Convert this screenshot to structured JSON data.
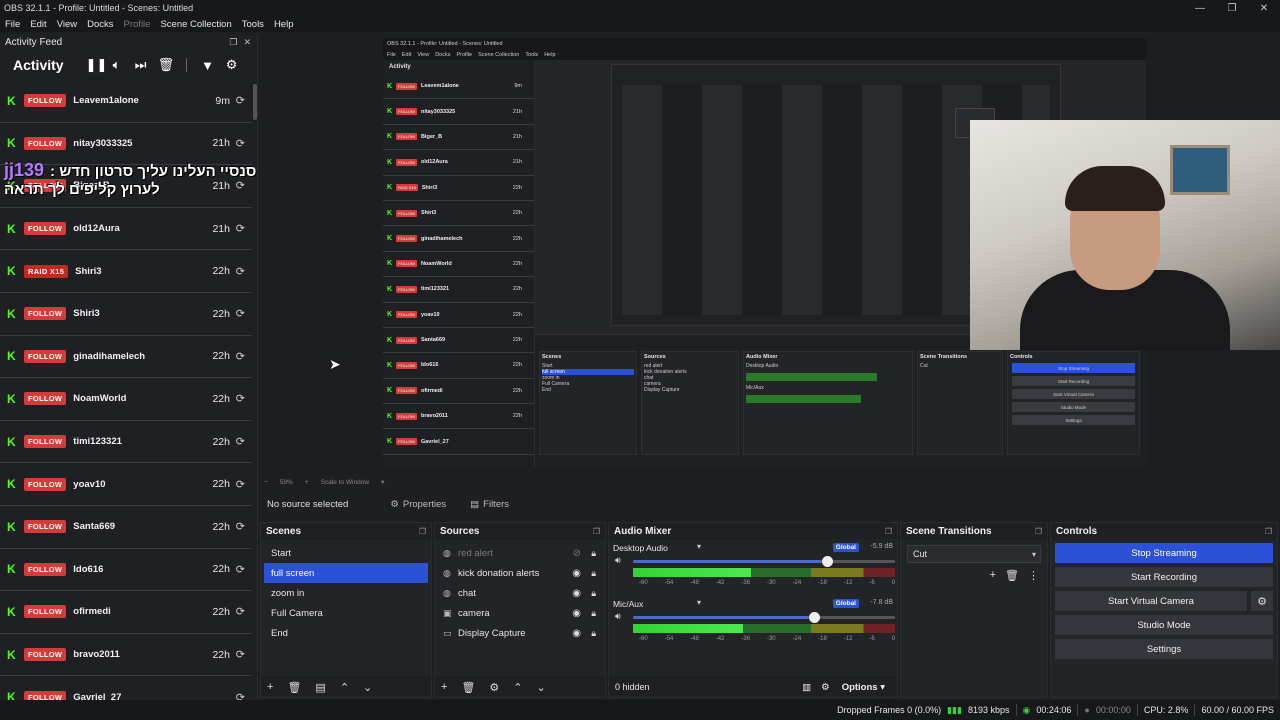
{
  "window": {
    "title": "OBS 32.1.1 - Profile: Untitled - Scenes: Untitled",
    "controls": [
      "—",
      "❐",
      "✕"
    ]
  },
  "menu": [
    "File",
    "Edit",
    "View",
    "Docks",
    "Profile",
    "Scene Collection",
    "Tools",
    "Help"
  ],
  "activity": {
    "dock_title": "Activity Feed",
    "title": "Activity",
    "items": [
      {
        "badge": "FOLLOW",
        "name": "Leavem1alone",
        "time": "9m"
      },
      {
        "badge": "FOLLOW",
        "name": "nitay3033325",
        "time": "21h"
      },
      {
        "badge": "FOLLOW",
        "name": "Biger_B",
        "time": "21h"
      },
      {
        "badge": "FOLLOW",
        "name": "old12Aura",
        "time": "21h"
      },
      {
        "badge": "RAID X15",
        "name": "Shiri3",
        "time": "22h"
      },
      {
        "badge": "FOLLOW",
        "name": "Shiri3",
        "time": "22h"
      },
      {
        "badge": "FOLLOW",
        "name": "ginadihamelech",
        "time": "22h"
      },
      {
        "badge": "FOLLOW",
        "name": "NoamWorld",
        "time": "22h"
      },
      {
        "badge": "FOLLOW",
        "name": "timi123321",
        "time": "22h"
      },
      {
        "badge": "FOLLOW",
        "name": "yoav10",
        "time": "22h"
      },
      {
        "badge": "FOLLOW",
        "name": "Santa669",
        "time": "22h"
      },
      {
        "badge": "FOLLOW",
        "name": "Ido616",
        "time": "22h"
      },
      {
        "badge": "FOLLOW",
        "name": "ofirmedi",
        "time": "22h"
      },
      {
        "badge": "FOLLOW",
        "name": "bravo2011",
        "time": "22h"
      },
      {
        "badge": "FOLLOW",
        "name": "Gavriel_27",
        "time": ""
      }
    ]
  },
  "chat_overlay": {
    "user": "jj139",
    "message_line1": "סנסיי העלינו עליך סרטון חדש :",
    "message_line2": "לערוץ קליפים לך תראה"
  },
  "preview": {
    "zoom_percent": "59%",
    "scale_mode": "Scale to Window"
  },
  "source_bar": {
    "no_source": "No source selected",
    "properties": "Properties",
    "filters": "Filters"
  },
  "scenes": {
    "title": "Scenes",
    "items": [
      "Start",
      "full screen",
      "zoom in",
      "Full Camera",
      "End"
    ],
    "selected": "full screen"
  },
  "sources": {
    "title": "Sources",
    "items": [
      {
        "name": "red alert",
        "icon": "globe-icon",
        "visible": false
      },
      {
        "name": "kick donation alerts",
        "icon": "globe-icon",
        "visible": true
      },
      {
        "name": "chat",
        "icon": "globe-icon",
        "visible": true
      },
      {
        "name": "camera",
        "icon": "camera-icon",
        "visible": true
      },
      {
        "name": "Display Capture",
        "icon": "monitor-icon",
        "visible": true
      }
    ]
  },
  "mixer": {
    "title": "Audio Mixer",
    "channels": [
      {
        "name": "Desktop Audio",
        "badge": "Global",
        "db": "-5.9 dB",
        "volume": 0.74,
        "level": 0.45
      },
      {
        "name": "Mic/Aux",
        "badge": "Global",
        "db": "-7.8 dB",
        "volume": 0.69,
        "level": 0.42
      }
    ],
    "ticks": [
      "-60",
      "-54",
      "-48",
      "-42",
      "-36",
      "-30",
      "-24",
      "-18",
      "-12",
      "-6",
      "0"
    ],
    "hidden": "0 hidden",
    "options": "Options"
  },
  "transitions": {
    "title": "Scene Transitions",
    "selected": "Cut"
  },
  "controls": {
    "title": "Controls",
    "stop_streaming": "Stop Streaming",
    "start_recording": "Start Recording",
    "start_virtual_camera": "Start Virtual Camera",
    "studio_mode": "Studio Mode",
    "settings": "Settings"
  },
  "status": {
    "dropped_frames": "Dropped Frames 0 (0.0%)",
    "bitrate": "8193 kbps",
    "stream_time": "00:24:06",
    "rec_time": "00:00:00",
    "cpu": "CPU: 2.8%",
    "fps": "60.00 / 60.00 FPS"
  },
  "colors": {
    "accent": "#2b52d6",
    "kick_green": "#53fc18",
    "follow_badge": "#d63a3a",
    "meter_green": "#34d234"
  }
}
